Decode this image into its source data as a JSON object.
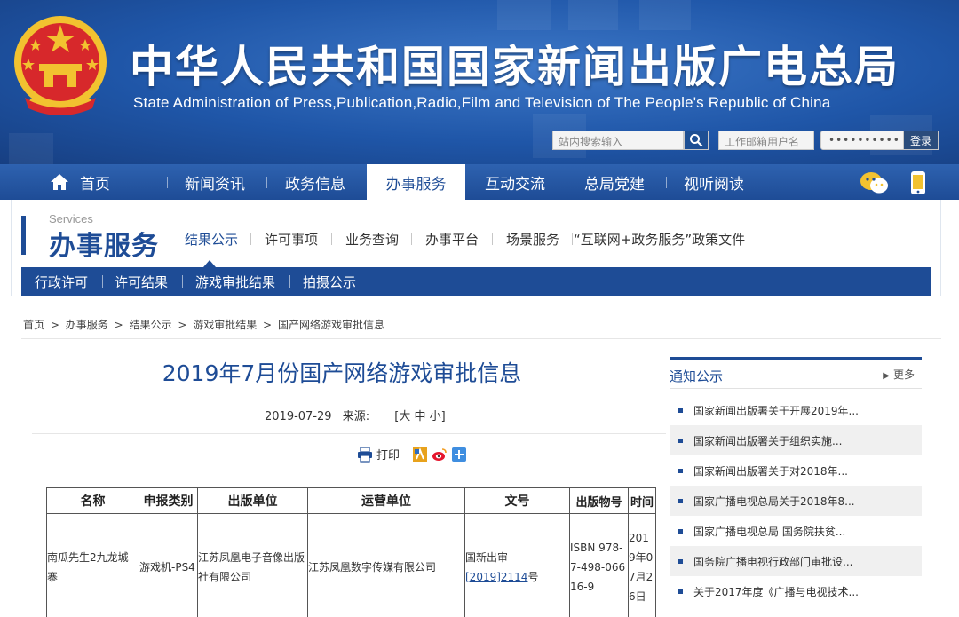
{
  "header": {
    "title": "中华人民共和国国家新闻出版广电总局",
    "subtitle": "State Administration of Press,Publication,Radio,Film and Television of The People's Republic of China",
    "search_placeholder": "站内搜索输入",
    "mail_placeholder": "工作邮箱用户名",
    "password_value": "••••••••••",
    "login_label": "登录"
  },
  "nav": {
    "items": [
      "首页",
      "新闻资讯",
      "政务信息",
      "办事服务",
      "互动交流",
      "总局党建",
      "视听阅读"
    ],
    "active": "办事服务"
  },
  "section": {
    "en": "Services",
    "cn": "办事服务",
    "links": [
      "结果公示",
      "许可事项",
      "业务查询",
      "办事平台",
      "场景服务",
      "“互联网+政务服务”政策文件"
    ],
    "sub_nav": [
      "行政许可",
      "许可结果",
      "游戏审批结果",
      "拍摄公示"
    ]
  },
  "breadcrumb": [
    "首页",
    ">",
    "办事服务",
    ">",
    "结果公示",
    ">",
    "游戏审批结果",
    ">",
    "国产网络游戏审批信息"
  ],
  "article": {
    "title": "2019年7月份国产网络游戏审批信息",
    "date": "2019-07-29",
    "source_label": "来源:",
    "font_size": "[大 中 小]",
    "print_label": "打印"
  },
  "table": {
    "headers": [
      "名称",
      "申报类别",
      "出版单位",
      "运营单位",
      "文号",
      "出版物号",
      "时间"
    ],
    "rows": [
      {
        "name": "南瓜先生2九龙城寨",
        "category": "游戏机-PS4",
        "publisher": "江苏凤凰电子音像出版社有限公司",
        "operator": "江苏凤凰数字传媒有限公司",
        "doc_prefix": "国新出审",
        "doc_link": "[2019]2114",
        "doc_suffix": "号",
        "isbn": "ISBN 978-7-498-06616-9",
        "date": "2019年07月26日"
      }
    ]
  },
  "sidebar": {
    "title": "通知公示",
    "more": "更多",
    "items": [
      "国家新闻出版署关于开展2019年...",
      "国家新闻出版署关于组织实施...",
      "国家新闻出版署关于对2018年...",
      "国家广播电视总局关于2018年8...",
      "国家广播电视总局 国务院扶贫...",
      "国务院广播电视行政部门审批设...",
      "关于2017年度《广播与电视技术..."
    ]
  },
  "colors": {
    "brand_blue": "#1e4c96",
    "banner_blue": "#2a5fae",
    "emblem_red": "#d7282b",
    "emblem_gold": "#f2c230"
  }
}
